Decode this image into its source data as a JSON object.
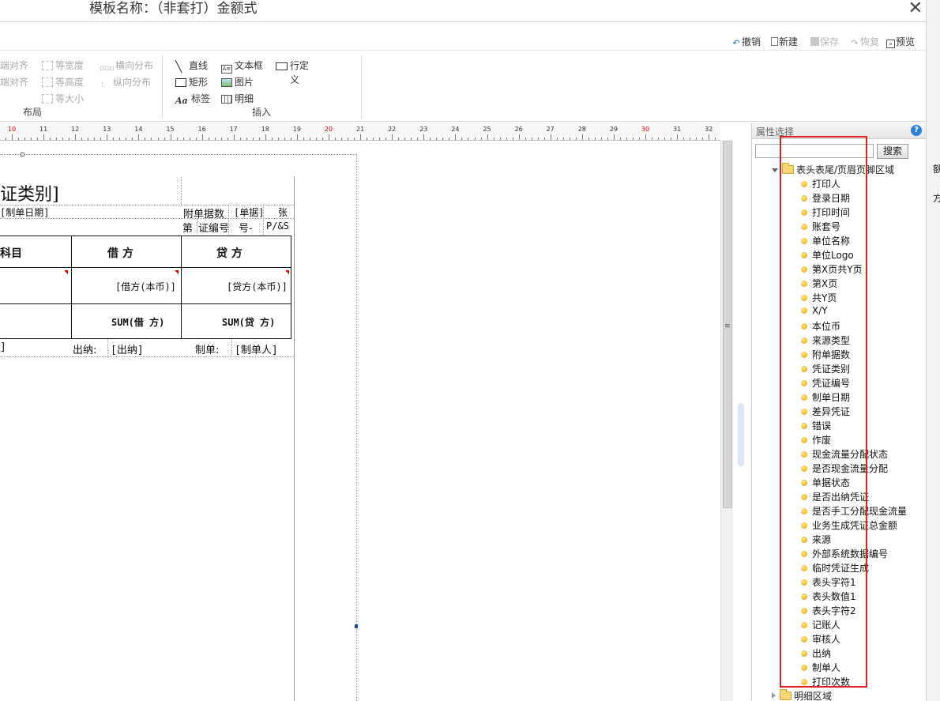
{
  "window": {
    "title": "模板名称：（非套打）金额式",
    "close_icon": "close-icon"
  },
  "toolbar": {
    "undo": "撤销",
    "new": "新建",
    "save": "保存",
    "redo": "恢复",
    "preview": "预览"
  },
  "ribbon": {
    "layout": {
      "align_1": "端对齐",
      "align_2": "端对齐",
      "equal_width": "等宽度",
      "equal_height": "等高度",
      "equal_size": "等大小",
      "h_distribute": "横向分布",
      "v_distribute": "纵向分布",
      "group_label": "布局"
    },
    "insert": {
      "line": "直线",
      "rect": "矩形",
      "label": "标签",
      "textbox": "文本框",
      "image": "图片",
      "detail": "明细",
      "custom_row": "行定",
      "custom_row_2": "义",
      "group_label": "插入"
    }
  },
  "ruler": {
    "labels": [
      "10",
      "11",
      "12",
      "13",
      "14",
      "15",
      "16",
      "17",
      "18",
      "19",
      "20",
      "21",
      "22",
      "23",
      "24",
      "25",
      "26",
      "27",
      "28",
      "29",
      "30",
      "31",
      "32"
    ],
    "red_labels": [
      "10",
      "20",
      "30"
    ]
  },
  "voucher": {
    "title": "证类别]",
    "date": "[制单日期]",
    "attach_label": "附单据数",
    "attach_value": "[单据]",
    "attach_unit": "张",
    "no_label": "第",
    "no_value": "证编号",
    "no_suffix": "号-",
    "page_expr": "P/&S",
    "col_subject": "科目",
    "col_debit": "借  方",
    "col_credit": "贷  方",
    "debit_field": "[借方(本币)]",
    "credit_field": "[贷方(本币)]",
    "sum_debit": "SUM(借  方)",
    "sum_credit": "SUM(贷  方)",
    "footer_left": "]",
    "cashier_label": "出纳:",
    "cashier_value": "[出纳]",
    "maker_label": "制单:",
    "maker_value": "[制单人]"
  },
  "panel": {
    "title": "属性选择",
    "search_placeholder": "",
    "search_button": "搜索",
    "root_node": "表头表尾/页眉页脚区域",
    "items": [
      "打印人",
      "登录日期",
      "打印时间",
      "账套号",
      "单位名称",
      "单位Logo",
      "第X页共Y页",
      "第X页",
      "共Y页",
      "X/Y",
      "本位币",
      "来源类型",
      "附单据数",
      "凭证类别",
      "凭证编号",
      "制单日期",
      "差异凭证",
      "错误",
      "作废",
      "现金流量分配状态",
      "是否现金流量分配",
      "单据状态",
      "是否出纳凭证",
      "是否手工分配现金流量",
      "业务生成凭证总金额",
      "来源",
      "外部系统数据编号",
      "临时凭证生成",
      "表头字符1",
      "表头数值1",
      "表头字符2",
      "记账人",
      "审核人",
      "出纳",
      "制单人",
      "打印次数"
    ],
    "detail_node": "明细区域"
  },
  "right_strip": {
    "char_1": "额",
    "char_2": "方"
  }
}
